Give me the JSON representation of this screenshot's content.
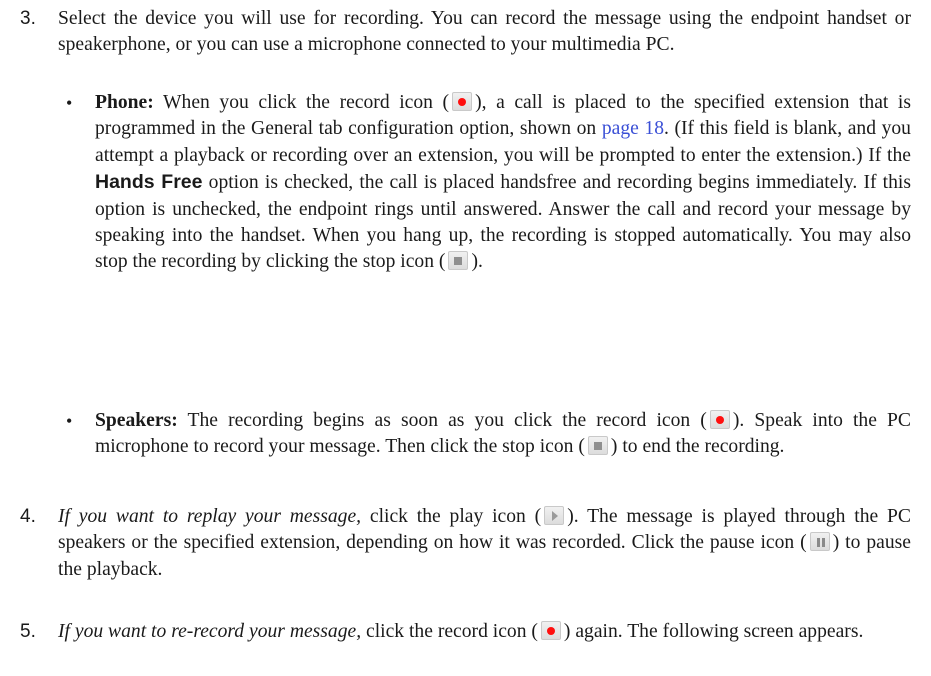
{
  "step3": {
    "number": "3.",
    "text": "Select the device you will use for recording. You can record the message using the endpoint handset or speakerphone, or you can use a microphone connected to your multimedia PC.",
    "phone": {
      "bullet": "•",
      "label": "Phone:",
      "t1": "When you click the record icon (",
      "t2": "), a call is placed to the specified extension that is programmed in the General tab configuration option, shown on",
      "link": "page 18",
      "t3": ". (If this field is blank, and you attempt a playback or recording over an extension, you will be prompted to enter the extension.) If the",
      "option": "Hands Free",
      "t4": "option is checked, the call is placed handsfree and recording begins immediately. If this option is unchecked, the endpoint rings until answered. Answer the call and record your message by speaking into the handset. When you hang up, the recording is stopped automatically. You may also stop the recording by clicking the stop icon (",
      "t5": ")."
    },
    "speakers": {
      "bullet": "•",
      "label": "Speakers:",
      "t1": "The recording begins as soon as you click the record icon (",
      "t2": "). Speak into the PC microphone to record your message. Then click the stop icon (",
      "t3": ") to end the recording."
    }
  },
  "step4": {
    "number": "4.",
    "italic": "If you want to replay your message,",
    "t1": "click the play icon (",
    "t2": "). The message is played through the PC speakers or the specified extension, depending on how it was recorded. Click the pause icon (",
    "t3": ") to pause the playback."
  },
  "step5": {
    "number": "5.",
    "italic": "If you want to re-record your message,",
    "t1": "click the record icon (",
    "t2": ") again. The following screen appears."
  },
  "icons": {
    "record": "record-icon",
    "stop": "stop-icon",
    "play": "play-icon",
    "pause": "pause-icon"
  },
  "colors": {
    "text": "#1a1a1a",
    "link": "#3a4fd6",
    "record": "#ff0f0f",
    "icon_button": "#e6e6e6"
  }
}
